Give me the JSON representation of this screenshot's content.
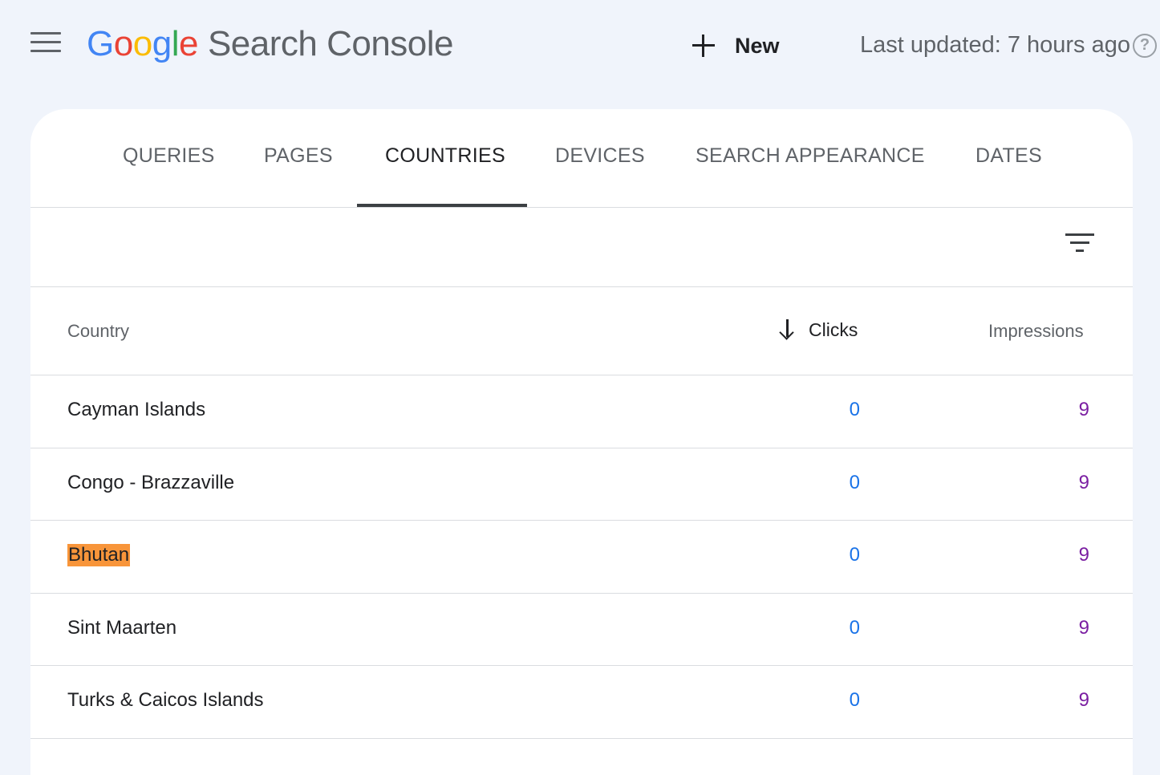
{
  "header": {
    "logo_letters": [
      "G",
      "o",
      "o",
      "g",
      "l",
      "e"
    ],
    "product_name": "Search Console",
    "new_label": "New",
    "last_updated": "Last updated: 7 hours ago",
    "help_glyph": "?"
  },
  "tabs": [
    {
      "label": "QUERIES",
      "active": false
    },
    {
      "label": "PAGES",
      "active": false
    },
    {
      "label": "COUNTRIES",
      "active": true
    },
    {
      "label": "DEVICES",
      "active": false
    },
    {
      "label": "SEARCH APPEARANCE",
      "active": false
    },
    {
      "label": "DATES",
      "active": false
    }
  ],
  "table": {
    "columns": {
      "country": "Country",
      "clicks": "Clicks",
      "impressions": "Impressions"
    },
    "sort": {
      "column": "clicks",
      "direction": "descending"
    },
    "rows": [
      {
        "country": "Cayman Islands",
        "clicks": "0",
        "impressions": "9",
        "highlighted": false
      },
      {
        "country": "Congo - Brazzaville",
        "clicks": "0",
        "impressions": "9",
        "highlighted": false
      },
      {
        "country": "Bhutan",
        "clicks": "0",
        "impressions": "9",
        "highlighted": true
      },
      {
        "country": "Sint Maarten",
        "clicks": "0",
        "impressions": "9",
        "highlighted": false
      },
      {
        "country": "Turks & Caicos Islands",
        "clicks": "0",
        "impressions": "9",
        "highlighted": false
      }
    ]
  },
  "colors": {
    "page_background": "#f0f4fb",
    "clicks_value": "#1a73e8",
    "impressions_value": "#7b1fa2",
    "highlight": "#f8953a"
  },
  "icons": [
    "menu-icon",
    "plus-icon",
    "help-icon",
    "filter-icon",
    "arrow-down-icon"
  ]
}
